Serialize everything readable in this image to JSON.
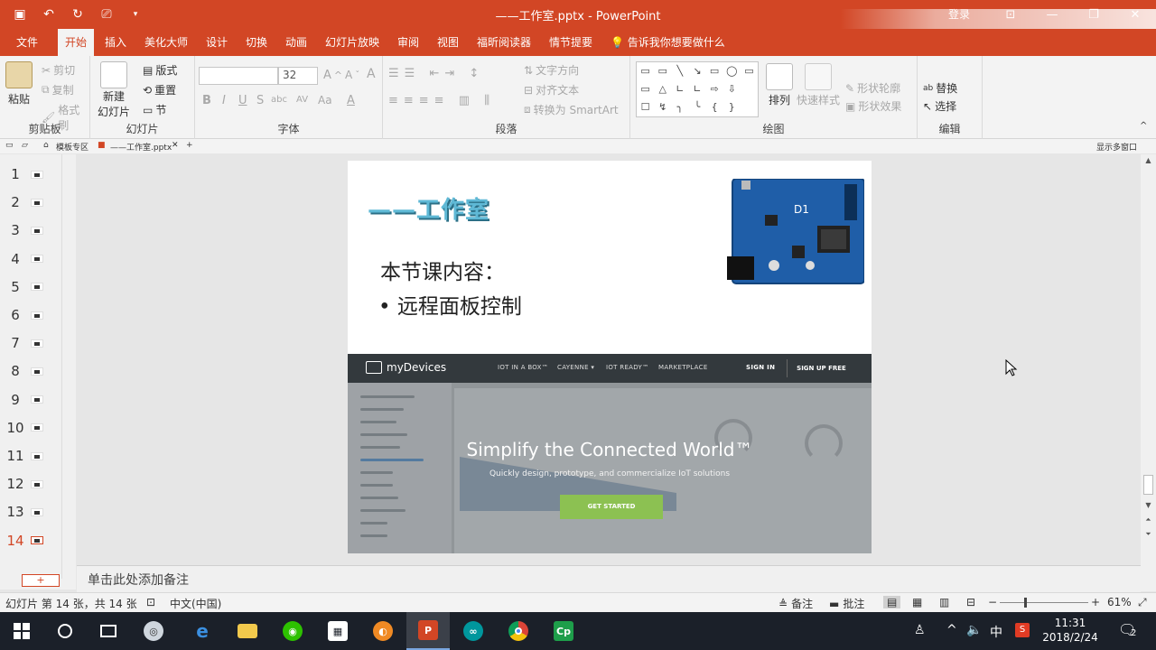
{
  "window": {
    "title": "——工作室.pptx  -  PowerPoint",
    "login": "登录",
    "qat": [
      "save-icon",
      "undo-icon",
      "redo-icon",
      "present-icon",
      "customize-icon"
    ]
  },
  "ribbon_tabs": [
    {
      "label": "文件"
    },
    {
      "label": "开始",
      "active": true
    },
    {
      "label": "插入"
    },
    {
      "label": "美化大师"
    },
    {
      "label": "设计"
    },
    {
      "label": "切换"
    },
    {
      "label": "动画"
    },
    {
      "label": "幻灯片放映"
    },
    {
      "label": "审阅"
    },
    {
      "label": "视图"
    },
    {
      "label": "福昕阅读器"
    },
    {
      "label": "情节提要"
    }
  ],
  "tell_me": "告诉我你想要做什么",
  "ribbon": {
    "clipboard": {
      "label": "剪贴板",
      "paste": "粘贴",
      "cut": "剪切",
      "copy": "复制",
      "format_painter": "格式刷"
    },
    "slides": {
      "label": "幻灯片",
      "new_slide_1": "新建",
      "new_slide_2": "幻灯片",
      "layout": "版式",
      "reset": "重置",
      "section": "节"
    },
    "font": {
      "label": "字体",
      "font_name": "",
      "font_size": "32",
      "bold": "B",
      "italic": "I",
      "underline": "U",
      "strike": "S",
      "shadow": "abc",
      "spacing": "AV",
      "case": "Aa",
      "color": "A"
    },
    "paragraph": {
      "label": "段落",
      "text_direction": "文字方向",
      "align_text": "对齐文本",
      "convert_smartart": "转换为 SmartArt"
    },
    "drawing": {
      "label": "绘图",
      "arrange": "排列",
      "quick_styles": "快速样式",
      "shape_outline": "形状轮廓",
      "shape_effects": "形状效果",
      "shape_glyphs": [
        "▭",
        "▭",
        "╲",
        "↘",
        "▭",
        "◯",
        "▭",
        "▭",
        "△",
        "∟",
        "∟",
        "⇨",
        "⇩",
        "",
        "☐",
        "↯",
        "╮",
        "╰",
        "{",
        "}",
        ""
      ]
    },
    "editing": {
      "label": "编辑",
      "replace": "替换",
      "select": "选择"
    }
  },
  "doc_tabs": {
    "templates": "模板专区",
    "file": "——工作室.pptx",
    "show_more": "显示多窗口"
  },
  "thumbnails": [
    {
      "num": "1"
    },
    {
      "num": "2"
    },
    {
      "num": "3"
    },
    {
      "num": "4"
    },
    {
      "num": "5"
    },
    {
      "num": "6"
    },
    {
      "num": "7"
    },
    {
      "num": "8"
    },
    {
      "num": "9"
    },
    {
      "num": "10"
    },
    {
      "num": "11"
    },
    {
      "num": "12"
    },
    {
      "num": "13"
    },
    {
      "num": "14",
      "active": true
    }
  ],
  "add_slide": "+",
  "slide": {
    "brand": "——工作室",
    "board_label": "D1",
    "heading": "本节课内容：",
    "bullet": "•  远程面板控制",
    "site": {
      "logo": "myDevices",
      "nav": [
        "IOT IN A BOX™",
        "CAYENNE ▾",
        "IOT READY™",
        "MARKETPLACE"
      ],
      "sign_in": "SIGN IN",
      "sign_up": "SIGN UP FREE",
      "hero": "Simplify the Connected World™",
      "subtitle": "Quickly design, prototype, and commercialize IoT solutions",
      "cta": "GET STARTED"
    }
  },
  "notes_placeholder": "单击此处添加备注",
  "status": {
    "slide_info": "幻灯片 第 14 张，共 14 张",
    "language": "中文(中国)",
    "notes": "备注",
    "comments": "批注",
    "zoom": "61%"
  },
  "taskbar": {
    "time": "11:31",
    "date": "2018/2/24",
    "ime": "中",
    "notif_count": "2",
    "apps": [
      "windows-start-icon",
      "search-circle-icon",
      "task-view-icon",
      "app-icon",
      "edge-icon",
      "file-explorer-icon",
      "wechat-icon",
      "store-icon",
      "app-orange-icon",
      "powerpoint-icon",
      "arduino-icon",
      "chrome-icon",
      "cp-icon"
    ]
  }
}
